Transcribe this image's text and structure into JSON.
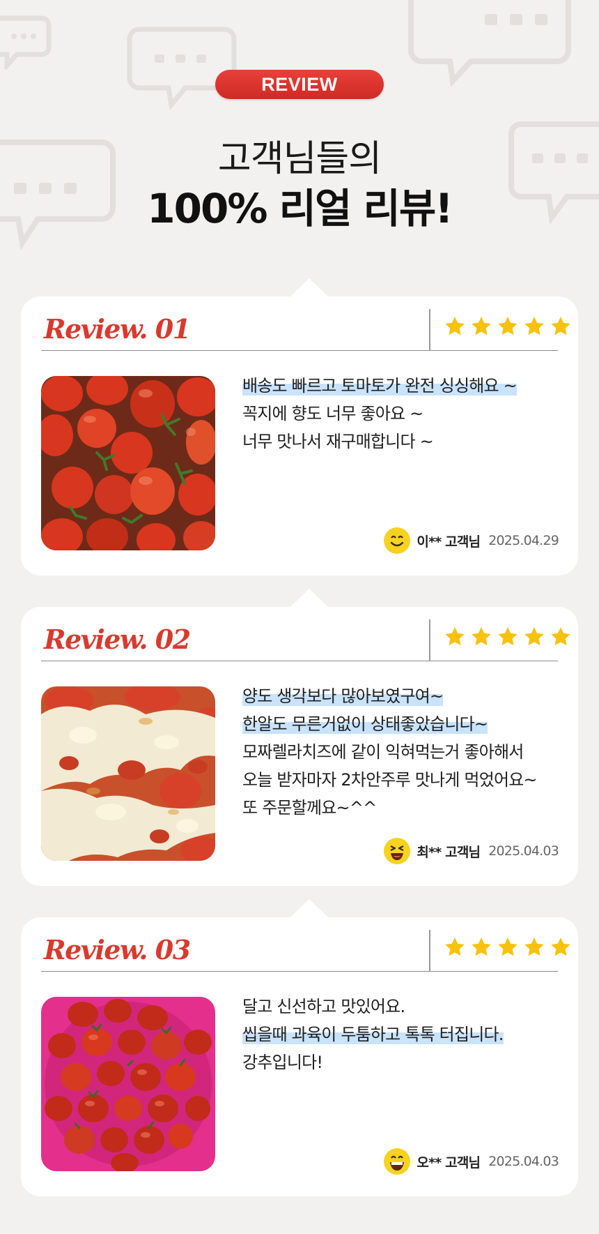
{
  "header": {
    "badge": "REVIEW",
    "title_line1": "고객님들의",
    "title_line2": "100% 리얼 리뷰!"
  },
  "colors": {
    "accent_red": "#d93a2e",
    "star_yellow": "#f7c20e",
    "highlight_blue": "#c9e3fb",
    "background": "#f3f1ef"
  },
  "reviews": [
    {
      "number_label": "Review. 01",
      "rating": 5,
      "lines": [
        {
          "text": "배송도 빠르고 토마토가 완전 싱싱해요 ~",
          "highlight": true
        },
        {
          "text": "꼭지에 향도 너무 좋아요 ~",
          "highlight": false
        },
        {
          "text": "너무 맛나서 재구매합니다 ~",
          "highlight": false
        }
      ],
      "author": "이** 고객님",
      "date": "2025.04.29",
      "emoji": "smiling-face-icon"
    },
    {
      "number_label": "Review. 02",
      "rating": 5,
      "lines": [
        {
          "text": "양도 생각보다 많아보였구여~",
          "highlight": true
        },
        {
          "text": "한알도 무른거없이 상태좋았습니다~",
          "highlight": true
        },
        {
          "text": "모짜렐라치즈에 같이 익혀먹는거 좋아해서",
          "highlight": false
        },
        {
          "text": "오늘 받자마자 2차안주루 맛나게 먹었어요~",
          "highlight": false
        },
        {
          "text": "또 주문할께요~^^",
          "highlight": false
        }
      ],
      "author": "최** 고객님",
      "date": "2025.04.03",
      "emoji": "laughing-face-icon"
    },
    {
      "number_label": "Review. 03",
      "rating": 5,
      "lines": [
        {
          "text": "달고 신선하고 맛있어요.",
          "highlight": false
        },
        {
          "text": "씹을때 과육이 두툼하고 톡톡 터집니다.",
          "highlight": true
        },
        {
          "text": "강추입니다!",
          "highlight": false
        }
      ],
      "author": "오** 고객님",
      "date": "2025.04.03",
      "emoji": "grinning-face-icon"
    }
  ]
}
